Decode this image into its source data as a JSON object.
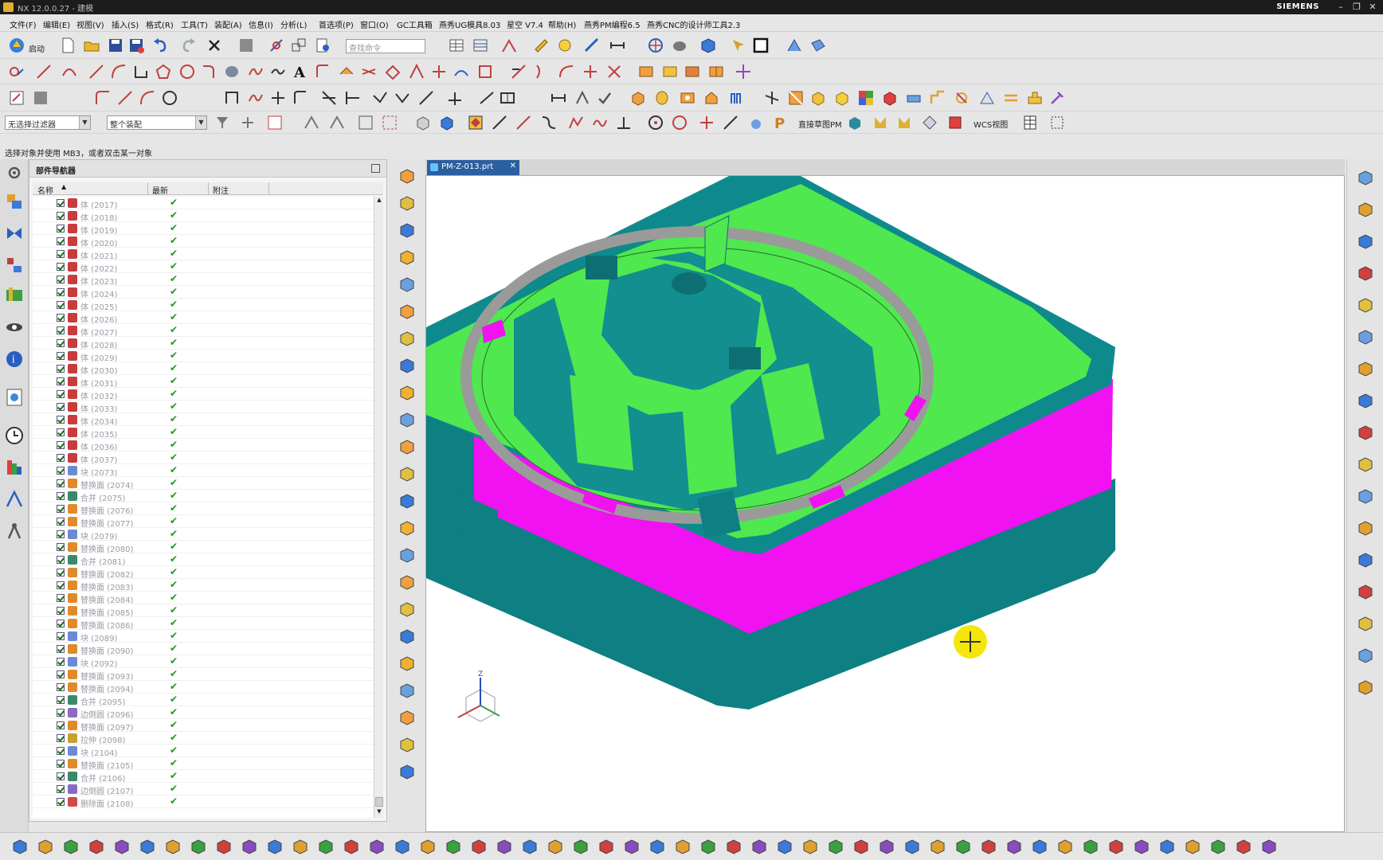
{
  "titlebar": {
    "title": "NX 12.0.0.27 - 建模",
    "brand": "SIEMENS"
  },
  "menu": {
    "items": [
      "文件(F)",
      "编辑(E)",
      "视图(V)",
      "插入(S)",
      "格式(R)",
      "工具(T)",
      "装配(A)",
      "信息(I)",
      "分析(L)",
      "首选项(P)",
      "窗口(O)",
      "GC工具箱",
      "燕秀UG模具8.03",
      "星空 V7.4",
      "帮助(H)",
      "燕秀PM编程6.5",
      "燕秀CNC的设计师工具2.3"
    ]
  },
  "toolbar": {
    "start_label": "启动",
    "search_placeholder": "查找命令",
    "filter_select": "无选择过滤器",
    "assembly_select": "整个装配",
    "direct_label": "直接草图PM",
    "wcs_label": "WCS视图"
  },
  "status": {
    "prompt": "选择对象并使用 MB3，或者双击某一对象"
  },
  "navigator": {
    "title": "部件导航器",
    "columns": {
      "name": "名称",
      "latest": "最新",
      "note": "附注"
    },
    "rows": [
      {
        "name": "体 (2017)",
        "icon": "body"
      },
      {
        "name": "体 (2018)",
        "icon": "body"
      },
      {
        "name": "体 (2019)",
        "icon": "body"
      },
      {
        "name": "体 (2020)",
        "icon": "body"
      },
      {
        "name": "体 (2021)",
        "icon": "body"
      },
      {
        "name": "体 (2022)",
        "icon": "body"
      },
      {
        "name": "体 (2023)",
        "icon": "body"
      },
      {
        "name": "体 (2024)",
        "icon": "body"
      },
      {
        "name": "体 (2025)",
        "icon": "body"
      },
      {
        "name": "体 (2026)",
        "icon": "body"
      },
      {
        "name": "体 (2027)",
        "icon": "body"
      },
      {
        "name": "体 (2028)",
        "icon": "body"
      },
      {
        "name": "体 (2029)",
        "icon": "body"
      },
      {
        "name": "体 (2030)",
        "icon": "body"
      },
      {
        "name": "体 (2031)",
        "icon": "body"
      },
      {
        "name": "体 (2032)",
        "icon": "body"
      },
      {
        "name": "体 (2033)",
        "icon": "body"
      },
      {
        "name": "体 (2034)",
        "icon": "body"
      },
      {
        "name": "体 (2035)",
        "icon": "body"
      },
      {
        "name": "体 (2036)",
        "icon": "body"
      },
      {
        "name": "体 (2037)",
        "icon": "body"
      },
      {
        "name": "块 (2073)",
        "icon": "block"
      },
      {
        "name": "替换面 (2074)",
        "icon": "replace"
      },
      {
        "name": "合并 (2075)",
        "icon": "unite"
      },
      {
        "name": "替换面 (2076)",
        "icon": "replace"
      },
      {
        "name": "替换面 (2077)",
        "icon": "replace"
      },
      {
        "name": "块 (2079)",
        "icon": "block"
      },
      {
        "name": "替换面 (2080)",
        "icon": "replace"
      },
      {
        "name": "合并 (2081)",
        "icon": "unite"
      },
      {
        "name": "替换面 (2082)",
        "icon": "replace"
      },
      {
        "name": "替换面 (2083)",
        "icon": "replace"
      },
      {
        "name": "替换面 (2084)",
        "icon": "replace"
      },
      {
        "name": "替换面 (2085)",
        "icon": "replace"
      },
      {
        "name": "替换面 (2086)",
        "icon": "replace"
      },
      {
        "name": "块 (2089)",
        "icon": "block"
      },
      {
        "name": "替换面 (2090)",
        "icon": "replace"
      },
      {
        "name": "块 (2092)",
        "icon": "block"
      },
      {
        "name": "替换面 (2093)",
        "icon": "replace"
      },
      {
        "name": "替换面 (2094)",
        "icon": "replace"
      },
      {
        "name": "合并 (2095)",
        "icon": "unite"
      },
      {
        "name": "边倒圆 (2096)",
        "icon": "blend"
      },
      {
        "name": "替换面 (2097)",
        "icon": "replace"
      },
      {
        "name": "拉伸 (2098)",
        "icon": "extrude"
      },
      {
        "name": "块 (2104)",
        "icon": "block"
      },
      {
        "name": "替换面 (2105)",
        "icon": "replace"
      },
      {
        "name": "合并 (2106)",
        "icon": "unite"
      },
      {
        "name": "边倒圆 (2107)",
        "icon": "blend"
      },
      {
        "name": "删除面 (2108)",
        "icon": "delete"
      }
    ]
  },
  "document": {
    "tab_label": "PM-Z-013.prt"
  },
  "colors": {
    "green": "#4fe84f",
    "teal": "#0e8a8c",
    "magenta": "#f012f0",
    "gray_ring": "#a0a0a0"
  },
  "icons": {
    "body": "#c83c3c",
    "block": "#6a8ad4",
    "replace": "#e08a2a",
    "unite": "#3a8a6a",
    "blend": "#8a6ac4",
    "extrude": "#c8a030",
    "delete": "#d04a4a"
  }
}
